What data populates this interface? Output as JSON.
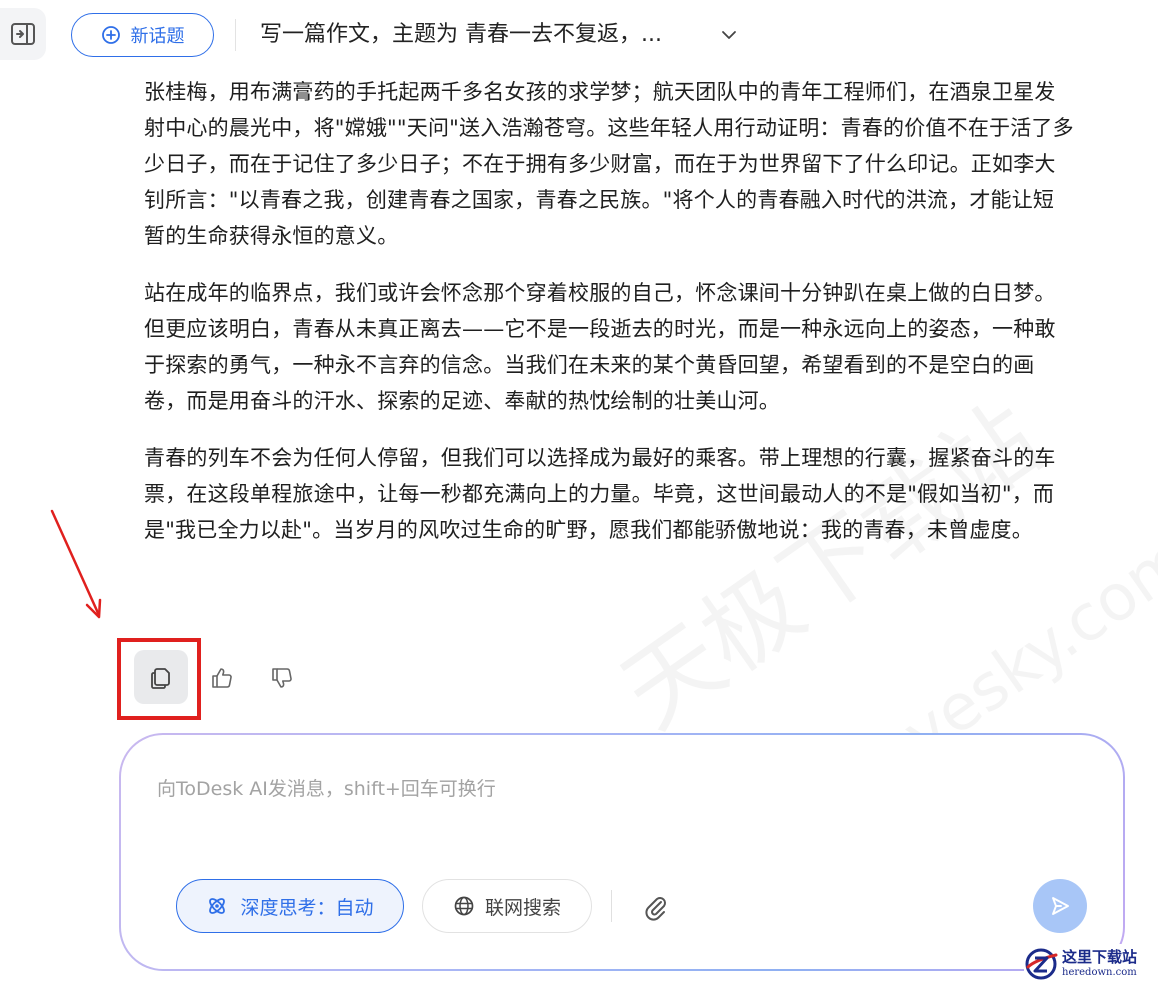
{
  "header": {
    "new_topic_label": "新话题",
    "topic_title": "写一篇作文，主题为 青春一去不复返，..."
  },
  "article": {
    "paragraphs": [
      "张桂梅，用布满膏药的手托起两千多名女孩的求学梦；航天团队中的青年工程师们，在酒泉卫星发射中心的晨光中，将\"嫦娥\"\"天问\"送入浩瀚苍穹。这些年轻人用行动证明：青春的价值不在于活了多少日子，而在于记住了多少日子；不在于拥有多少财富，而在于为世界留下了什么印记。正如李大钊所言：\"以青春之我，创建青春之国家，青春之民族。\"将个人的青春融入时代的洪流，才能让短暂的生命获得永恒的意义。",
      "站在成年的临界点，我们或许会怀念那个穿着校服的自己，怀念课间十分钟趴在桌上做的白日梦。但更应该明白，青春从未真正离去——它不是一段逝去的时光，而是一种永远向上的姿态，一种敢于探索的勇气，一种永不言弃的信念。当我们在未来的某个黄昏回望，希望看到的不是空白的画卷，而是用奋斗的汗水、探索的足迹、奉献的热忱绘制的壮美山河。",
      "青春的列车不会为任何人停留，但我们可以选择成为最好的乘客。带上理想的行囊，握紧奋斗的车票，在这段单程旅途中，让每一秒都充满向上的力量。毕竟，这世间最动人的不是\"假如当初\"，而是\"我已全力以赴\"。当岁月的风吹过生命的旷野，愿我们都能骄傲地说：我的青春，未曾虚度。"
    ]
  },
  "actions": {
    "icons": [
      "copy-icon",
      "thumbs-up-icon",
      "thumbs-down-icon"
    ]
  },
  "composer": {
    "placeholder": "向ToDesk AI发消息，shift+回车可换行",
    "value": "",
    "deep_think_label": "深度思考：自动",
    "web_search_label": "联网搜索"
  },
  "watermark": {
    "main": "天极下载站",
    "url": "mydown.yesky.com"
  },
  "corner_logo": {
    "main": "这里下载站",
    "sub": "heredown.com"
  },
  "colors": {
    "accent": "#2f6fe8",
    "highlight": "#e0201e",
    "send_button": "#a8c6f7"
  }
}
